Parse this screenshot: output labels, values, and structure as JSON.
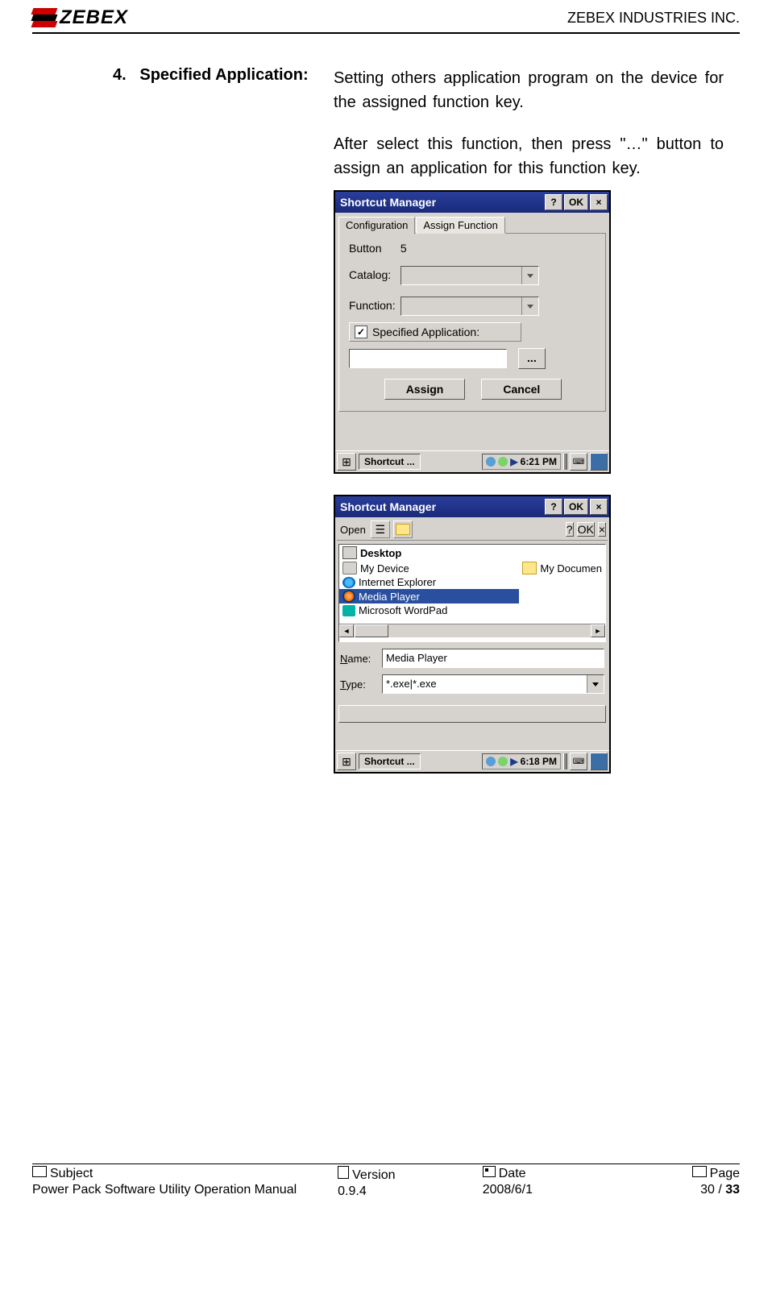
{
  "header": {
    "logo_text": "ZEBEX",
    "company": "ZEBEX INDUSTRIES INC."
  },
  "section": {
    "number": "4.",
    "title": "Specified Application:",
    "desc1": "Setting others application  program on the device for the assigned function key.",
    "desc2": "After select this function, then press \"…\" button to assign an application for this function key."
  },
  "shot1": {
    "title": "Shortcut Manager",
    "help": "?",
    "ok": "OK",
    "close": "×",
    "tab1": "Configuration",
    "tab2": "Assign Function",
    "button_lbl": "Button",
    "button_num": "5",
    "catalog_lbl": "Catalog:",
    "function_lbl": "Function:",
    "spec_app_lbl": "Specified Application:",
    "check_mark": "✓",
    "browse": "...",
    "assign": "Assign",
    "cancel": "Cancel",
    "taskbtn": "Shortcut ...",
    "tray_time": "6:21 PM"
  },
  "shot2": {
    "title": "Shortcut Manager",
    "help": "?",
    "ok": "OK",
    "close": "×",
    "open": "Open",
    "inner_help": "?",
    "inner_ok": "OK",
    "inner_close": "×",
    "desktop_hdr": "Desktop",
    "items": [
      "My Device",
      "My Documen",
      "Internet Explorer",
      "Media Player",
      "Microsoft WordPad"
    ],
    "name_lbl": "Name:",
    "name_val": "Media Player",
    "type_lbl": "Type:",
    "type_val": "*.exe|*.exe",
    "taskbtn": "Shortcut ...",
    "tray_time": "6:18 PM"
  },
  "footer": {
    "subject_lbl": "Subject",
    "subject_val": "Power Pack Software Utility Operation Manual",
    "version_lbl": "Version",
    "version_val": "0.9.4",
    "date_lbl": "Date",
    "date_val": "2008/6/1",
    "page_lbl": "Page",
    "page_val_pre": "30 / ",
    "page_val_bold": "33"
  }
}
